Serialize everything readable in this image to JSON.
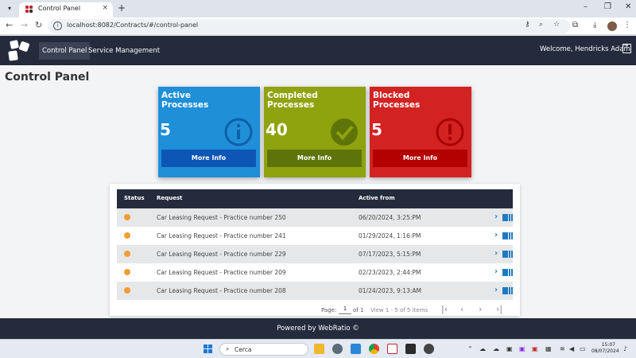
{
  "browser": {
    "tab_title": "Control Panel",
    "tab_close": "×",
    "new_tab": "+",
    "url": "localhost:8082/Contracts/#/control-panel",
    "back": "←",
    "forward": "→",
    "reload": "↻",
    "min": "–",
    "restore": "❐",
    "close": "✕"
  },
  "header": {
    "nav": [
      "Control Panel",
      "Service Management"
    ],
    "welcome": "Welcome, Hendricks Adam"
  },
  "page": {
    "title": "Control Panel"
  },
  "cards": [
    {
      "title": "Active Processes",
      "count": "5",
      "button": "More Info",
      "color": "#1f8fd8",
      "button_color": "#0d56b5",
      "icon": "info-icon"
    },
    {
      "title": "Completed Processes",
      "count": "40",
      "button": "More Info",
      "color": "#8fa30f",
      "button_color": "#5f7408",
      "icon": "check-icon"
    },
    {
      "title": "Blocked Processes",
      "count": "5",
      "button": "More Info",
      "color": "#d32222",
      "button_color": "#b30000",
      "icon": "alert-icon"
    }
  ],
  "table": {
    "headers": {
      "status": "Status",
      "request": "Request",
      "active_from": "Active from"
    },
    "rows": [
      {
        "request": "Car Leasing Request - Practice number 250",
        "active_from": "06/20/2024, 3:25:PM"
      },
      {
        "request": "Car Leasing Request - Practice number 241",
        "active_from": "01/29/2024, 1:16:PM"
      },
      {
        "request": "Car Leasing Request - Practice number 229",
        "active_from": "07/17/2023, 5:15:PM"
      },
      {
        "request": "Car Leasing Request - Practice number 209",
        "active_from": "02/23/2023, 2:44:PM"
      },
      {
        "request": "Car Leasing Request - Practice number 208",
        "active_from": "01/24/2023, 9:13:AM"
      }
    ],
    "status_color": "#f29d33",
    "pager": {
      "page_label": "Page:",
      "page_value": "1",
      "of_label": "of 1",
      "view_label": "View 1 - 5 of 5 items",
      "first": "|‹",
      "prev": "‹",
      "next": "›",
      "last": "›|"
    }
  },
  "footer": {
    "text": "Powered by WebRatio ©"
  },
  "taskbar": {
    "search": "Cerca",
    "time": "15:07",
    "date": "08/07/2024"
  }
}
